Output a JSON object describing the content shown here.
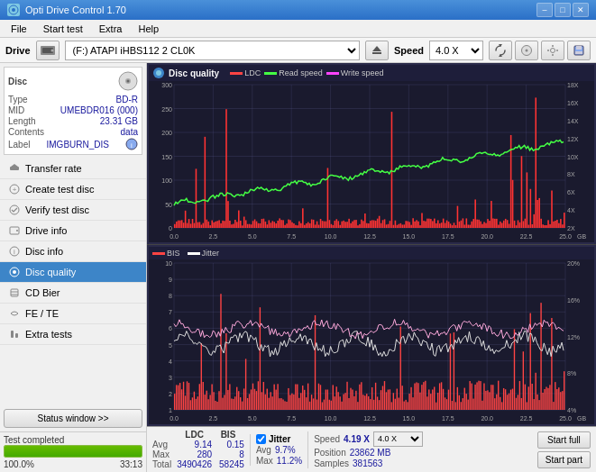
{
  "titleBar": {
    "title": "Opti Drive Control 1.70",
    "minimize": "–",
    "maximize": "□",
    "close": "✕"
  },
  "menuBar": {
    "items": [
      "File",
      "Start test",
      "Extra",
      "Help"
    ]
  },
  "driveBar": {
    "label": "Drive",
    "driveValue": "(F:)  ATAPI iHBS112  2 CL0K",
    "speedLabel": "Speed",
    "speedValue": "4.0 X"
  },
  "disc": {
    "type_label": "Type",
    "type_value": "BD-R",
    "mid_label": "MID",
    "mid_value": "UMEBDR016 (000)",
    "length_label": "Length",
    "length_value": "23.31 GB",
    "contents_label": "Contents",
    "contents_value": "data",
    "label_label": "Label",
    "label_value": "IMGBURN_DIS"
  },
  "sidebar": {
    "items": [
      {
        "id": "transfer-rate",
        "label": "Transfer rate"
      },
      {
        "id": "create-test-disc",
        "label": "Create test disc"
      },
      {
        "id": "verify-test-disc",
        "label": "Verify test disc"
      },
      {
        "id": "drive-info",
        "label": "Drive info"
      },
      {
        "id": "disc-info",
        "label": "Disc info"
      },
      {
        "id": "disc-quality",
        "label": "Disc quality",
        "active": true
      },
      {
        "id": "cd-bier",
        "label": "CD Bier"
      },
      {
        "id": "fe-te",
        "label": "FE / TE"
      },
      {
        "id": "extra-tests",
        "label": "Extra tests"
      }
    ],
    "statusBtn": "Status window >>",
    "statusText": "Test completed",
    "progressPercent": 100,
    "progressLabel": "100.0%",
    "timeLabel": "33:13"
  },
  "chartTop": {
    "title": "Disc quality",
    "legends": [
      {
        "id": "ldc",
        "label": "LDC",
        "color": "#ff4444"
      },
      {
        "id": "read-speed",
        "label": "Read speed",
        "color": "#44ff44"
      },
      {
        "id": "write-speed",
        "label": "Write speed",
        "color": "#ff44ff"
      }
    ],
    "yLeft": [
      "300",
      "250",
      "200",
      "150",
      "100",
      "50",
      "0"
    ],
    "yRight": [
      "18X",
      "16X",
      "14X",
      "12X",
      "10X",
      "8X",
      "6X",
      "4X",
      "2X"
    ],
    "xLabels": [
      "0.0",
      "2.5",
      "5.0",
      "7.5",
      "10.0",
      "12.5",
      "15.0",
      "17.5",
      "20.0",
      "22.5",
      "25.0 GB"
    ]
  },
  "chartBottom": {
    "legends": [
      {
        "id": "bis",
        "label": "BIS",
        "color": "#ff4444"
      },
      {
        "id": "jitter",
        "label": "Jitter",
        "color": "#ffffff"
      }
    ],
    "yLeft": [
      "10",
      "9",
      "8",
      "7",
      "6",
      "5",
      "4",
      "3",
      "2",
      "1"
    ],
    "yRight": [
      "20%",
      "16%",
      "12%",
      "8%",
      "4%"
    ],
    "xLabels": [
      "0.0",
      "2.5",
      "5.0",
      "7.5",
      "10.0",
      "12.5",
      "15.0",
      "17.5",
      "20.0",
      "22.5",
      "25.0 GB"
    ]
  },
  "stats": {
    "columns": [
      "",
      "LDC",
      "BIS"
    ],
    "rows": [
      {
        "label": "Avg",
        "ldc": "9.14",
        "bis": "0.15"
      },
      {
        "label": "Max",
        "ldc": "280",
        "bis": "8"
      },
      {
        "label": "Total",
        "ldc": "3490426",
        "bis": "58245"
      }
    ],
    "jitter": {
      "checked": true,
      "label": "Jitter",
      "avg": "9.7%",
      "max": "11.2%",
      "avgLabel": "Avg",
      "maxLabel": "Max"
    },
    "speed": {
      "speedLabel": "Speed",
      "speedValue": "4.19 X",
      "speedSelectValue": "4.0 X",
      "positionLabel": "Position",
      "positionValue": "23862 MB",
      "samplesLabel": "Samples",
      "samplesValue": "381563"
    },
    "buttons": {
      "startFull": "Start full",
      "startPart": "Start part"
    }
  }
}
